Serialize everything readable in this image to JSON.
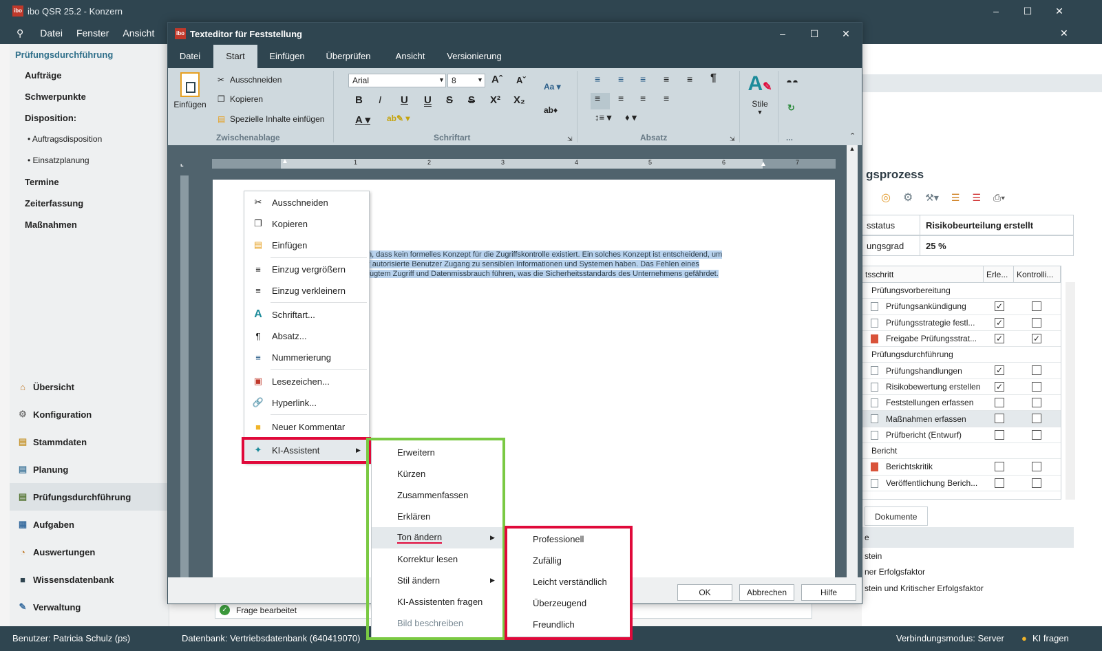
{
  "app": {
    "title": "ibo QSR 25.2 - Konzern",
    "menu": [
      "Datei",
      "Fenster",
      "Ansicht"
    ],
    "logo_text": "ibo"
  },
  "sidebar": {
    "header": "Prüfungsdurchführung",
    "items": [
      "Aufträge",
      "Schwerpunkte",
      "Disposition:",
      "Auftragsdisposition",
      "Einsatzplanung",
      "Termine",
      "Zeiterfassung",
      "Maßnahmen"
    ],
    "nav": [
      "Übersicht",
      "Konfiguration",
      "Stammdaten",
      "Planung",
      "Prüfungsdurchführung",
      "Aufgaben",
      "Auswertungen",
      "Wissensdatenbank",
      "Verwaltung"
    ],
    "active_nav": "Prüfungsdurchführung"
  },
  "statusbar": {
    "user": "Benutzer: Patricia Schulz (ps)",
    "database": "Datenbank: Vertriebsdatenbank (640419070)",
    "connection": "Verbindungsmodus: Server",
    "ki": "KI fragen"
  },
  "right_panel": {
    "title_fragment": "gsprozess",
    "status_label": "sstatus",
    "status_value": "Risikobeurteilung erstellt",
    "grad_label": "ungsgrad",
    "grad_value": "25 %",
    "grid_headers": [
      "tsschritt",
      "Erle...",
      "Kontrolli..."
    ],
    "rows": [
      {
        "type": "group",
        "name": "Prüfungsvorbereitung"
      },
      {
        "type": "doc",
        "name": "Prüfungsankündigung",
        "erl": "✓",
        "kon": ""
      },
      {
        "type": "doc",
        "name": "Prüfungsstrategie festl...",
        "erl": "✓",
        "kon": ""
      },
      {
        "type": "red",
        "name": "Freigabe Prüfungsstrat...",
        "erl": "✓",
        "kon": "✓"
      },
      {
        "type": "group",
        "name": "Prüfungsdurchführung"
      },
      {
        "type": "doc",
        "name": "Prüfungshandlungen",
        "erl": "✓",
        "kon": ""
      },
      {
        "type": "doc",
        "name": "Risikobewertung erstellen",
        "erl": "✓",
        "kon": ""
      },
      {
        "type": "doc",
        "name": "Feststellungen erfassen",
        "erl": "",
        "kon": ""
      },
      {
        "type": "doc",
        "name": "Maßnahmen erfassen",
        "erl": "",
        "kon": ""
      },
      {
        "type": "doc",
        "name": "Prüfbericht (Entwurf)",
        "erl": "",
        "kon": ""
      },
      {
        "type": "group",
        "name": "Bericht"
      },
      {
        "type": "red",
        "name": "Berichtskritik",
        "erl": "",
        "kon": ""
      },
      {
        "type": "doc",
        "name": "Veröffentlichung Berich...",
        "erl": "",
        "kon": ""
      }
    ],
    "tab_documents": "Dokumente",
    "lower_letter": "e",
    "lower_items": [
      "stein",
      "ner Erfolgsfaktor",
      "stein und Kritischer Erfolgsfaktor"
    ]
  },
  "dialog": {
    "title": "Texteditor für Feststellung",
    "tabs": [
      "Datei",
      "Start",
      "Einfügen",
      "Überprüfen",
      "Ansicht",
      "Versionierung"
    ],
    "active_tab": "Start",
    "clipboard": {
      "paste": "Einfügen",
      "cut": "Ausschneiden",
      "copy": "Kopieren",
      "special": "Spezielle Inhalte einfügen",
      "group": "Zwischenablage"
    },
    "font": {
      "name": "Arial",
      "size": "8",
      "group": "Schriftart",
      "case": "Aa"
    },
    "paragraph_group": "Absatz",
    "styles_label": "Stile",
    "more": "...",
    "ruler_numbers": [
      "1",
      "2",
      "3",
      "4",
      "5",
      "6",
      "7"
    ],
    "selected_text": [
      "n, dass kein formelles Konzept für die Zugriffskontrolle existiert. Ein solches Konzept ist entscheidend, um",
      "r autorisierte Benutzer Zugang zu sensiblen Informationen und Systemen haben. Das Fehlen eines",
      "fugtem Zugriff und Datenmissbrauch führen, was die Sicherheitsstandards des Unternehmens gefährdet."
    ],
    "buttons": {
      "ok": "OK",
      "cancel": "Abbrechen",
      "help": "Hilfe"
    }
  },
  "behind_bar": "Frage bearbeitet",
  "context_menu": {
    "items": [
      "Ausschneiden",
      "Kopieren",
      "Einfügen",
      "Einzug vergrößern",
      "Einzug verkleinern",
      "Schriftart...",
      "Absatz...",
      "Nummerierung",
      "Lesezeichen...",
      "Hyperlink...",
      "Neuer Kommentar",
      "KI-Assistent"
    ]
  },
  "ki_menu": {
    "items": [
      "Erweitern",
      "Kürzen",
      "Zusammenfassen",
      "Erklären",
      "Ton ändern",
      "Korrektur lesen",
      "Stil ändern",
      "KI-Assistenten fragen",
      "Bild beschreiben"
    ]
  },
  "tone_menu": {
    "items": [
      "Professionell",
      "Zufällig",
      "Leicht verständlich",
      "Überzeugend",
      "Freundlich"
    ]
  },
  "colors": {
    "chrome": "#2f4550",
    "ribbon": "#cfd9de",
    "highlight_red": "#e0093a",
    "highlight_green": "#7ac943",
    "selection": "#b9d3ee"
  }
}
